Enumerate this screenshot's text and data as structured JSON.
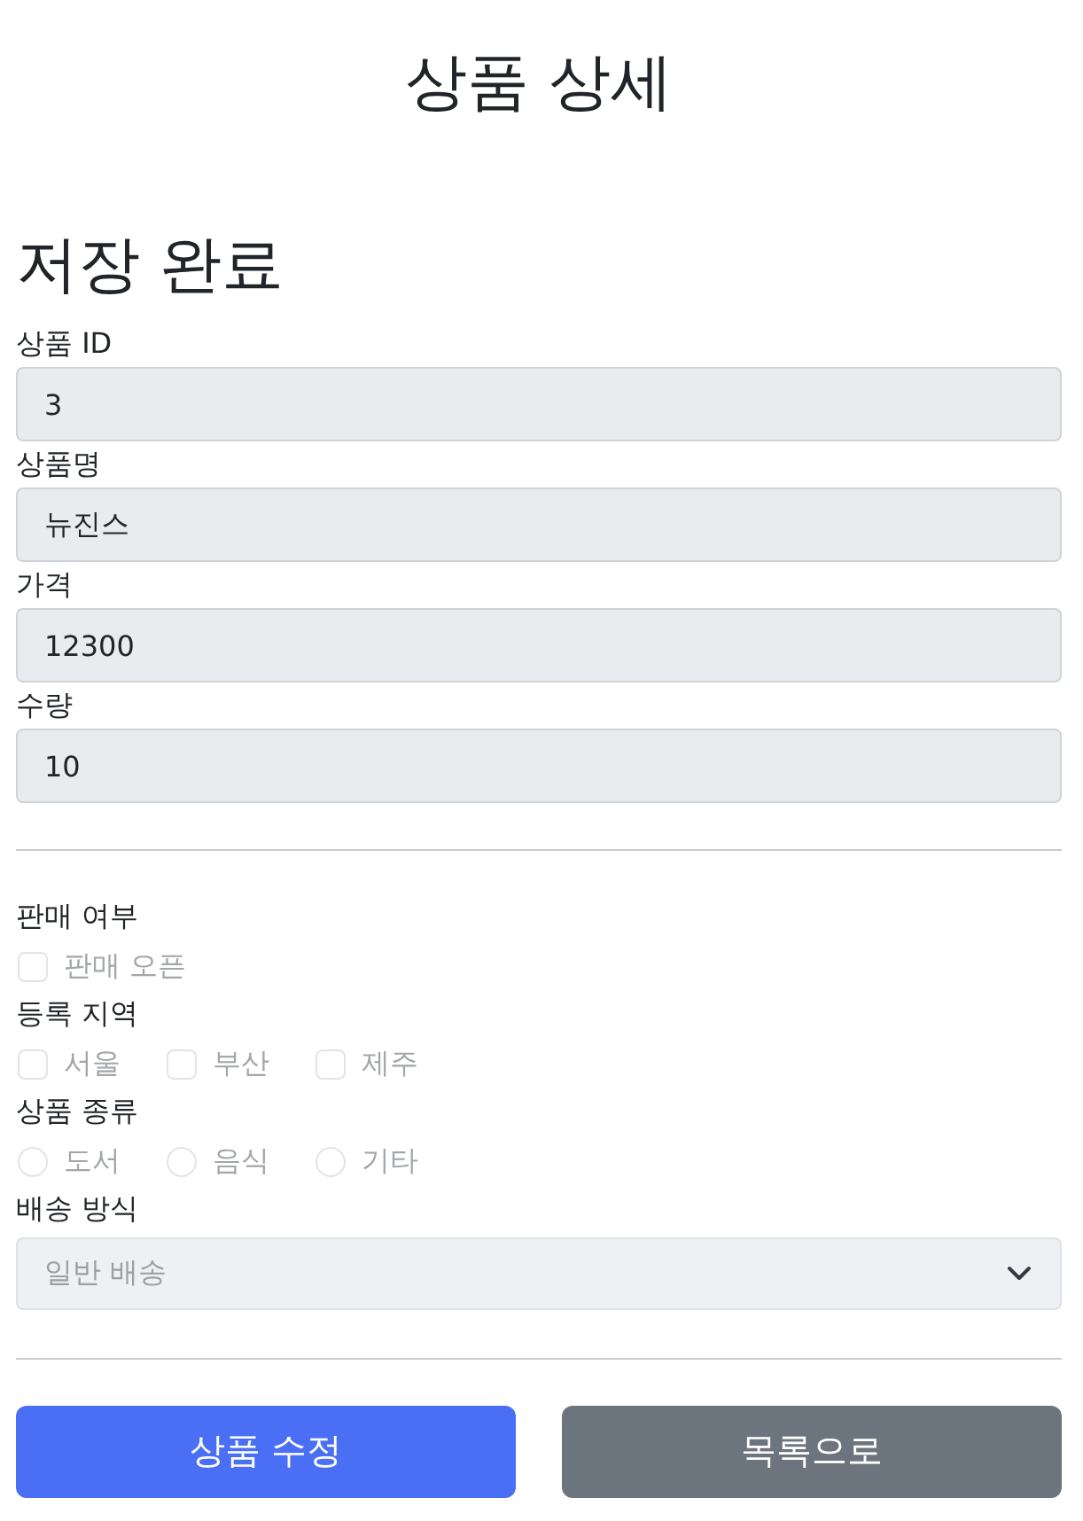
{
  "page_title": "상품 상세",
  "status_message": "저장 완료",
  "fields": [
    {
      "label": "상품 ID",
      "value": "3"
    },
    {
      "label": "상품명",
      "value": "뉴진스"
    },
    {
      "label": "가격",
      "value": "12300"
    },
    {
      "label": "수량",
      "value": "10"
    }
  ],
  "option_groups": [
    {
      "label": "판매 여부",
      "kind": "checkbox",
      "options": [
        {
          "label": "판매 오픈",
          "checked": false,
          "disabled": true
        }
      ]
    },
    {
      "label": "등록 지역",
      "kind": "checkbox",
      "options": [
        {
          "label": "서울",
          "checked": false,
          "disabled": true
        },
        {
          "label": "부산",
          "checked": false,
          "disabled": true
        },
        {
          "label": "제주",
          "checked": false,
          "disabled": true
        }
      ]
    },
    {
      "label": "상품 종류",
      "kind": "radio",
      "options": [
        {
          "label": "도서",
          "selected": false,
          "disabled": true
        },
        {
          "label": "음식",
          "selected": false,
          "disabled": true
        },
        {
          "label": "기타",
          "selected": false,
          "disabled": true
        }
      ]
    }
  ],
  "delivery": {
    "label": "배송 방식",
    "value": "일반 배송",
    "disabled": true
  },
  "buttons": [
    {
      "label": "상품 수정",
      "kind": "primary"
    },
    {
      "label": "목록으로",
      "kind": "secondary"
    }
  ]
}
